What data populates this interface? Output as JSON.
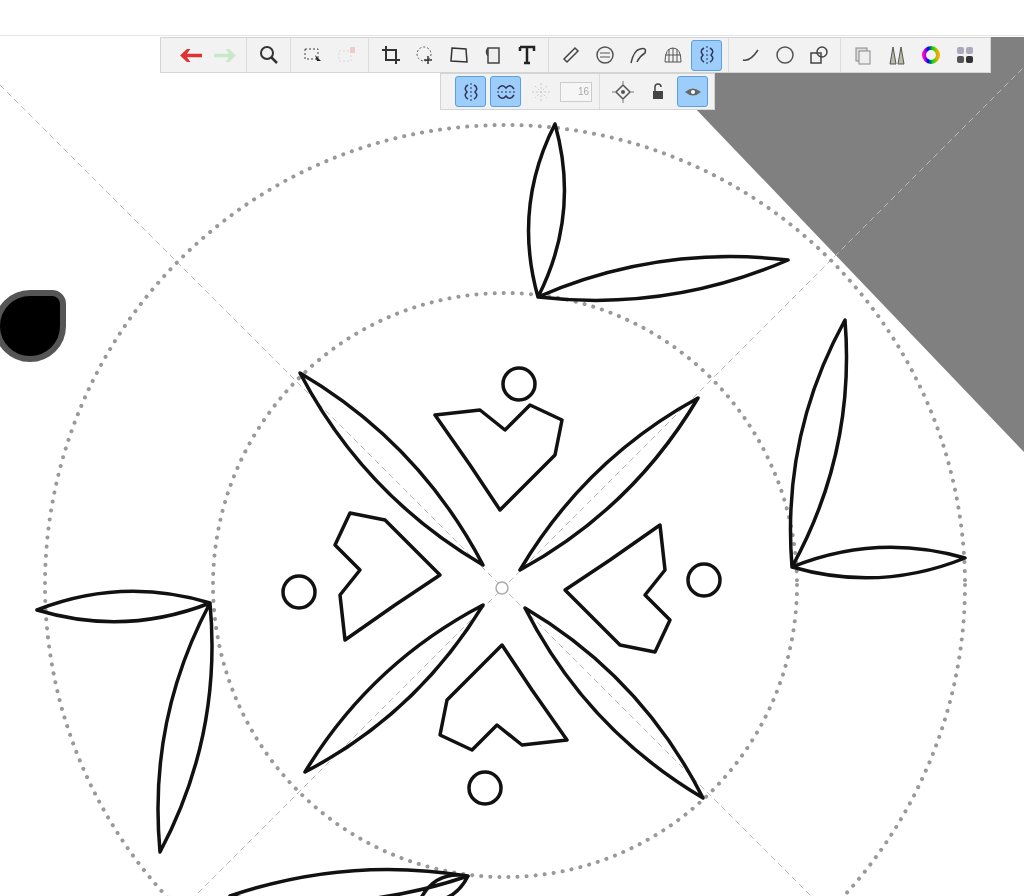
{
  "toolbar": {
    "tools": [
      {
        "selected": false,
        "disabled": false
      },
      {
        "selected": false,
        "disabled": true
      },
      {
        "selected": false,
        "disabled": false
      },
      {
        "selected": false,
        "disabled": false
      },
      {
        "selected": false,
        "disabled": true
      },
      {
        "selected": false,
        "disabled": false
      },
      {
        "selected": false,
        "disabled": false
      },
      {
        "selected": false,
        "disabled": false
      },
      {
        "selected": false,
        "disabled": false
      },
      {
        "selected": false,
        "disabled": false
      },
      {
        "selected": false,
        "disabled": false
      },
      {
        "selected": false,
        "disabled": false
      },
      {
        "selected": false,
        "disabled": false
      },
      {
        "selected": false,
        "disabled": false
      },
      {
        "selected": true,
        "disabled": false
      },
      {
        "selected": false,
        "disabled": false
      },
      {
        "selected": false,
        "disabled": false
      },
      {
        "selected": false,
        "disabled": false
      },
      {
        "selected": false,
        "disabled": false
      },
      {
        "selected": false,
        "disabled": false
      },
      {
        "selected": false,
        "disabled": false
      },
      {
        "selected": false,
        "disabled": false
      }
    ]
  },
  "symmetry_bar": {
    "modes": [
      {
        "selected": true,
        "disabled": false
      },
      {
        "selected": true,
        "disabled": false
      },
      {
        "selected": false,
        "disabled": true
      }
    ],
    "count_field": {
      "value": "16",
      "disabled": true
    },
    "actions": [
      {
        "selected": false
      },
      {
        "selected": false
      },
      {
        "selected": true
      }
    ]
  }
}
